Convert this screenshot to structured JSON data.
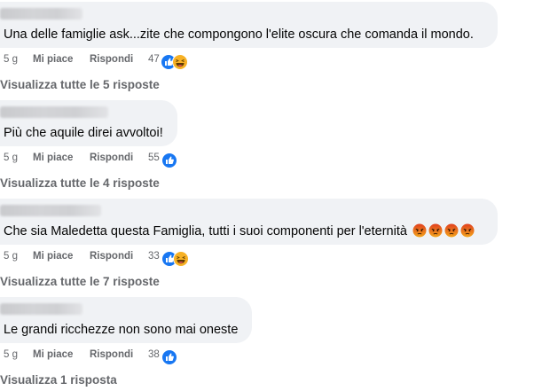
{
  "comments": [
    {
      "text": "Una delle famiglie ask...zite che compongono l'elite oscura che comanda il mondo.",
      "time": "5 g",
      "like": "Mi piace",
      "reply": "Rispondi",
      "reaction_count": "47",
      "reactions": [
        "like-icon",
        "haha-icon"
      ],
      "view_replies": "Visualizza tutte le 5 risposte"
    },
    {
      "text": "Più che aquile direi avvoltoi!",
      "time": "5 g",
      "like": "Mi piace",
      "reply": "Rispondi",
      "reaction_count": "55",
      "reactions": [
        "like-icon"
      ],
      "view_replies": "Visualizza tutte le 4 risposte"
    },
    {
      "text": "Che sia Maledetta questa Famiglia, tutti i suoi componenti per l'eternità",
      "text_emojis": [
        "angry-emoji",
        "angry-emoji",
        "angry-emoji",
        "angry-emoji"
      ],
      "time": "5 g",
      "like": "Mi piace",
      "reply": "Rispondi",
      "reaction_count": "33",
      "reactions": [
        "like-icon",
        "haha-icon"
      ],
      "view_replies": "Visualizza tutte le 7 risposte"
    },
    {
      "text": "Le grandi ricchezze non sono mai oneste",
      "time": "5 g",
      "like": "Mi piace",
      "reply": "Rispondi",
      "reaction_count": "38",
      "reactions": [
        "like-icon"
      ],
      "view_replies": "Visualizza 1 risposta"
    }
  ],
  "colors": {
    "bubble": "#f0f2f5",
    "meta_text": "#65676b",
    "like_blue": "#1877f2",
    "haha_yellow": "#f7b125",
    "angry_red": "#e9710f"
  }
}
